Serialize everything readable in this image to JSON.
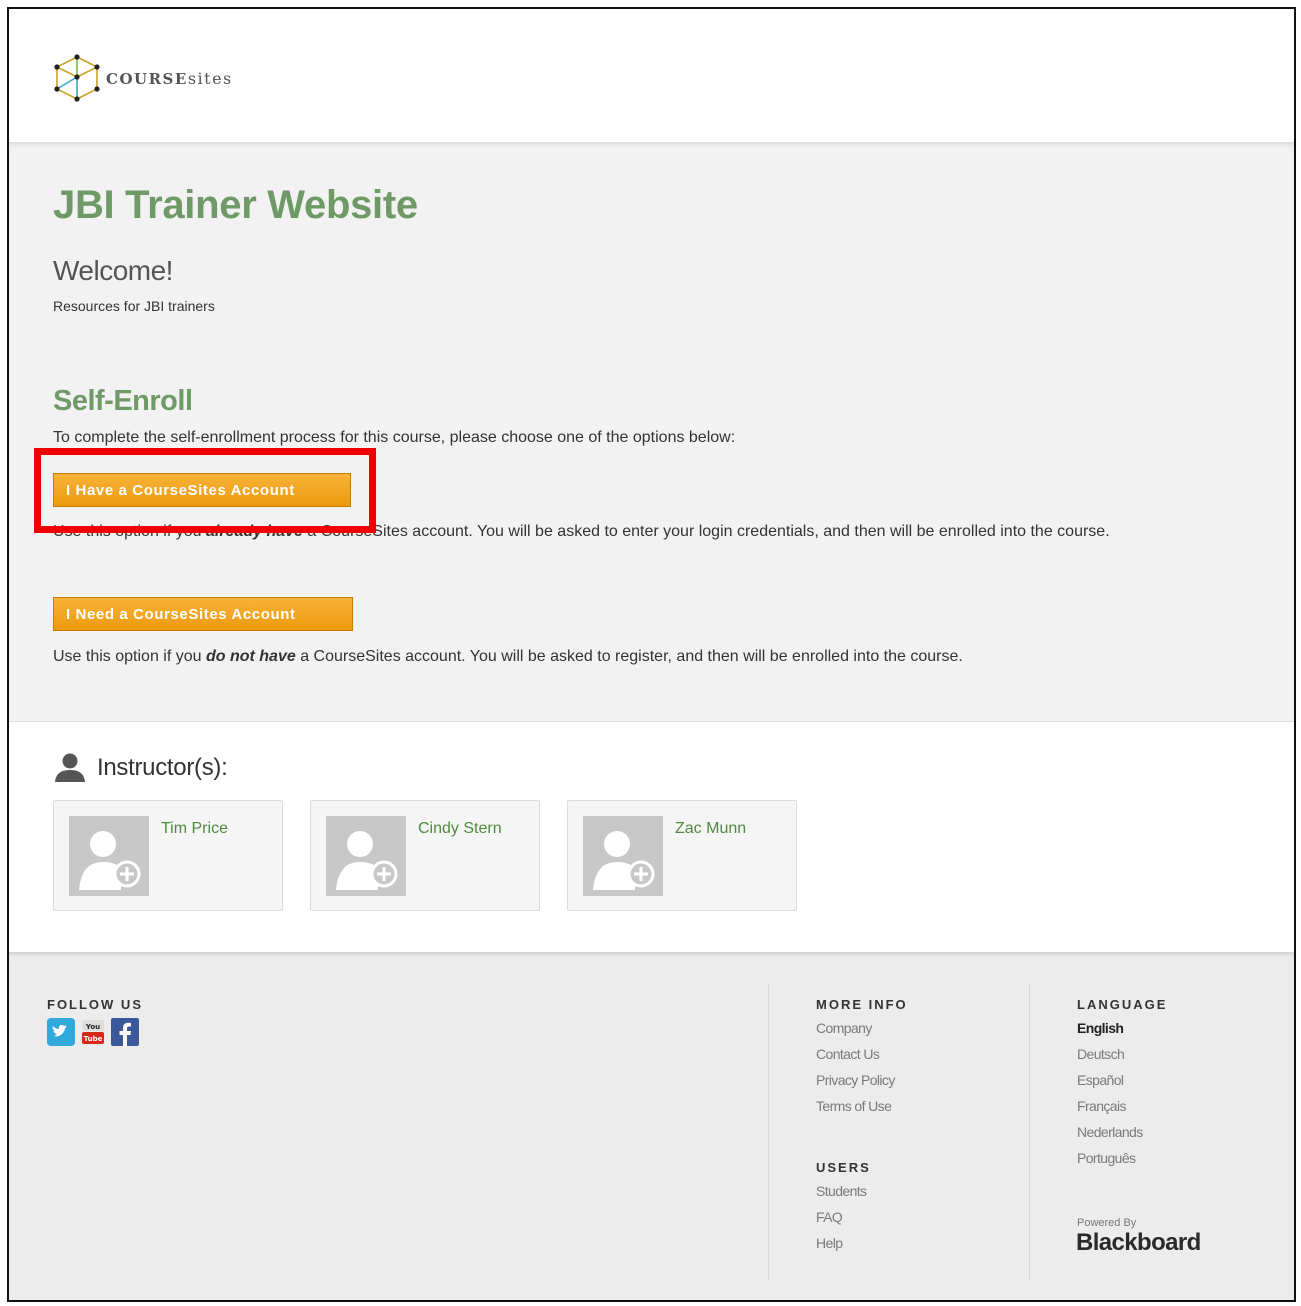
{
  "header": {
    "logo_bold": "COURSE",
    "logo_light": "sites"
  },
  "main": {
    "title": "JBI Trainer Website",
    "welcome": "Welcome!",
    "subtitle": "Resources for JBI trainers",
    "self_enroll": {
      "title": "Self-Enroll",
      "intro": "To complete the self-enrollment process for this course, please choose one of the options below:",
      "have_account": {
        "button": "I Have a CourseSites Account",
        "desc_prefix": "Use this option if you ",
        "desc_emphasis": "already have",
        "desc_suffix": " a CourseSites account. You will be asked to enter your login credentials, and then will be enrolled into the course."
      },
      "need_account": {
        "button": "I Need a CourseSites Account",
        "desc_prefix": "Use this option if you ",
        "desc_emphasis": "do not have",
        "desc_suffix": " a CourseSites account. You will be asked to register, and then will be enrolled into the course."
      }
    }
  },
  "instructors": {
    "label": "Instructor(s):",
    "people": [
      {
        "name": "Tim Price"
      },
      {
        "name": "Cindy Stern"
      },
      {
        "name": "Zac Munn"
      }
    ]
  },
  "footer": {
    "follow_us": "FOLLOW US",
    "social_icons": [
      "twitter-icon",
      "youtube-icon",
      "facebook-icon"
    ],
    "more_info": {
      "title": "MORE INFO",
      "links": [
        "Company",
        "Contact Us",
        "Privacy Policy",
        "Terms of Use"
      ]
    },
    "users": {
      "title": "USERS",
      "links": [
        "Students",
        "FAQ",
        "Help"
      ]
    },
    "language": {
      "title": "LANGUAGE",
      "options": [
        "English",
        "Deutsch",
        "Español",
        "Français",
        "Nederlands",
        "Português"
      ],
      "selected": "English"
    },
    "powered_by": "Powered By",
    "brand": "Blackboard"
  },
  "colors": {
    "accent_green": "#6f9a67",
    "button_orange": "#f0a21a",
    "highlight_red": "#ee0000"
  }
}
